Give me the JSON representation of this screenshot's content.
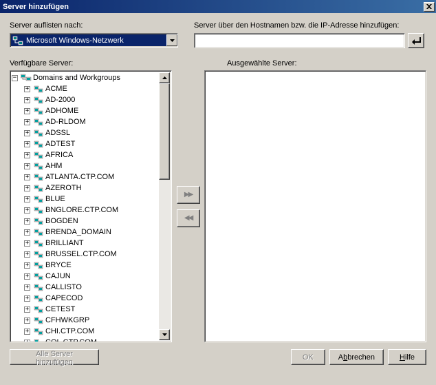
{
  "window": {
    "title": "Server hinzufügen"
  },
  "labels": {
    "list_by": "Server auflisten nach:",
    "add_by_host": "Server über den Hostnamen bzw. die IP-Adresse hinzufügen:",
    "available": "Verfügbare Server:",
    "selected": "Ausgewählte Server:"
  },
  "dropdown": {
    "value": "Microsoft Windows-Netzwerk"
  },
  "hostname": {
    "value": ""
  },
  "tree": {
    "root": "Domains and Workgroups",
    "items": [
      "ACME",
      "AD-2000",
      "ADHOME",
      "AD-RLDOM",
      "ADSSL",
      "ADTEST",
      "AFRICA",
      "AHM",
      "ATLANTA.CTP.COM",
      "AZEROTH",
      "BLUE",
      "BNGLORE.CTP.COM",
      "BOGDEN",
      "BRENDA_DOMAIN",
      "BRILLIANT",
      "BRUSSEL.CTP.COM",
      "BRYCE",
      "CAJUN",
      "CALLISTO",
      "CAPECOD",
      "CETEST",
      "CFHWKGRP",
      "CHI.CTP.COM",
      "COL.CTP.COM"
    ]
  },
  "buttons": {
    "add_all": "Alle Server hinzufügen",
    "ok": "OK",
    "cancel_pre": "A",
    "cancel_u": "b",
    "cancel_post": "brechen",
    "help_u": "H",
    "help_post": "ilfe"
  }
}
